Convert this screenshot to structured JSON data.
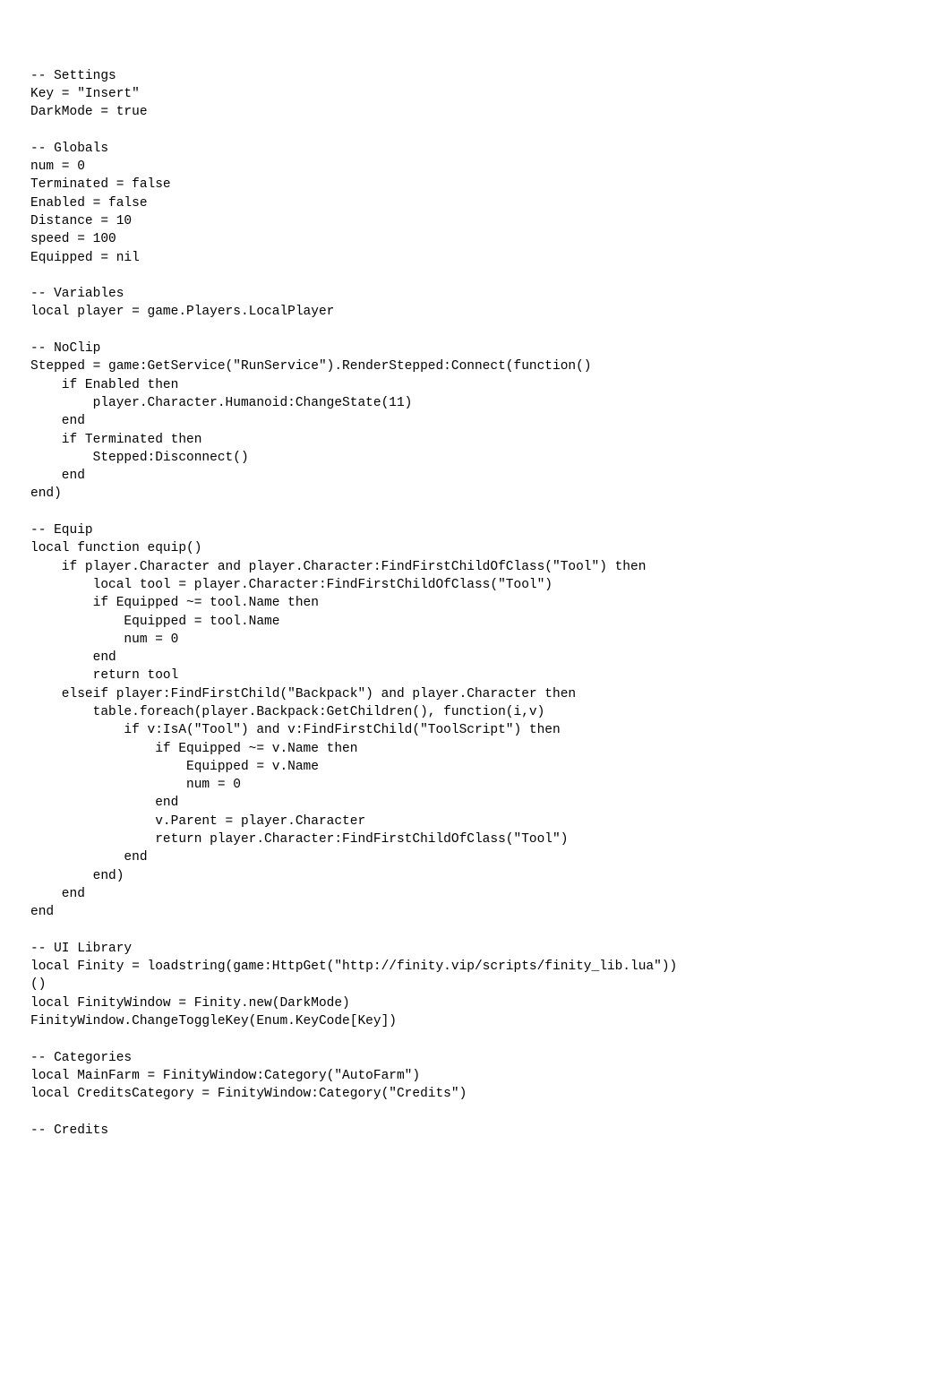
{
  "code": "-- Settings\nKey = \"Insert\"\nDarkMode = true\n\n-- Globals\nnum = 0\nTerminated = false\nEnabled = false\nDistance = 10\nspeed = 100\nEquipped = nil\n\n-- Variables\nlocal player = game.Players.LocalPlayer\n\n-- NoClip\nStepped = game:GetService(\"RunService\").RenderStepped:Connect(function()\n    if Enabled then\n        player.Character.Humanoid:ChangeState(11)\n    end\n    if Terminated then\n        Stepped:Disconnect()\n    end\nend)\n\n-- Equip\nlocal function equip()\n    if player.Character and player.Character:FindFirstChildOfClass(\"Tool\") then\n        local tool = player.Character:FindFirstChildOfClass(\"Tool\")\n        if Equipped ~= tool.Name then\n            Equipped = tool.Name\n            num = 0\n        end\n        return tool\n    elseif player:FindFirstChild(\"Backpack\") and player.Character then\n        table.foreach(player.Backpack:GetChildren(), function(i,v)\n            if v:IsA(\"Tool\") and v:FindFirstChild(\"ToolScript\") then\n                if Equipped ~= v.Name then\n                    Equipped = v.Name\n                    num = 0\n                end\n                v.Parent = player.Character\n                return player.Character:FindFirstChildOfClass(\"Tool\")\n            end\n        end)\n    end\nend\n\n-- UI Library\nlocal Finity = loadstring(game:HttpGet(\"http://finity.vip/scripts/finity_lib.lua\"))\n()\nlocal FinityWindow = Finity.new(DarkMode)\nFinityWindow.ChangeToggleKey(Enum.KeyCode[Key])\n\n-- Categories\nlocal MainFarm = FinityWindow:Category(\"AutoFarm\")\nlocal CreditsCategory = FinityWindow:Category(\"Credits\")\n\n-- Credits"
}
